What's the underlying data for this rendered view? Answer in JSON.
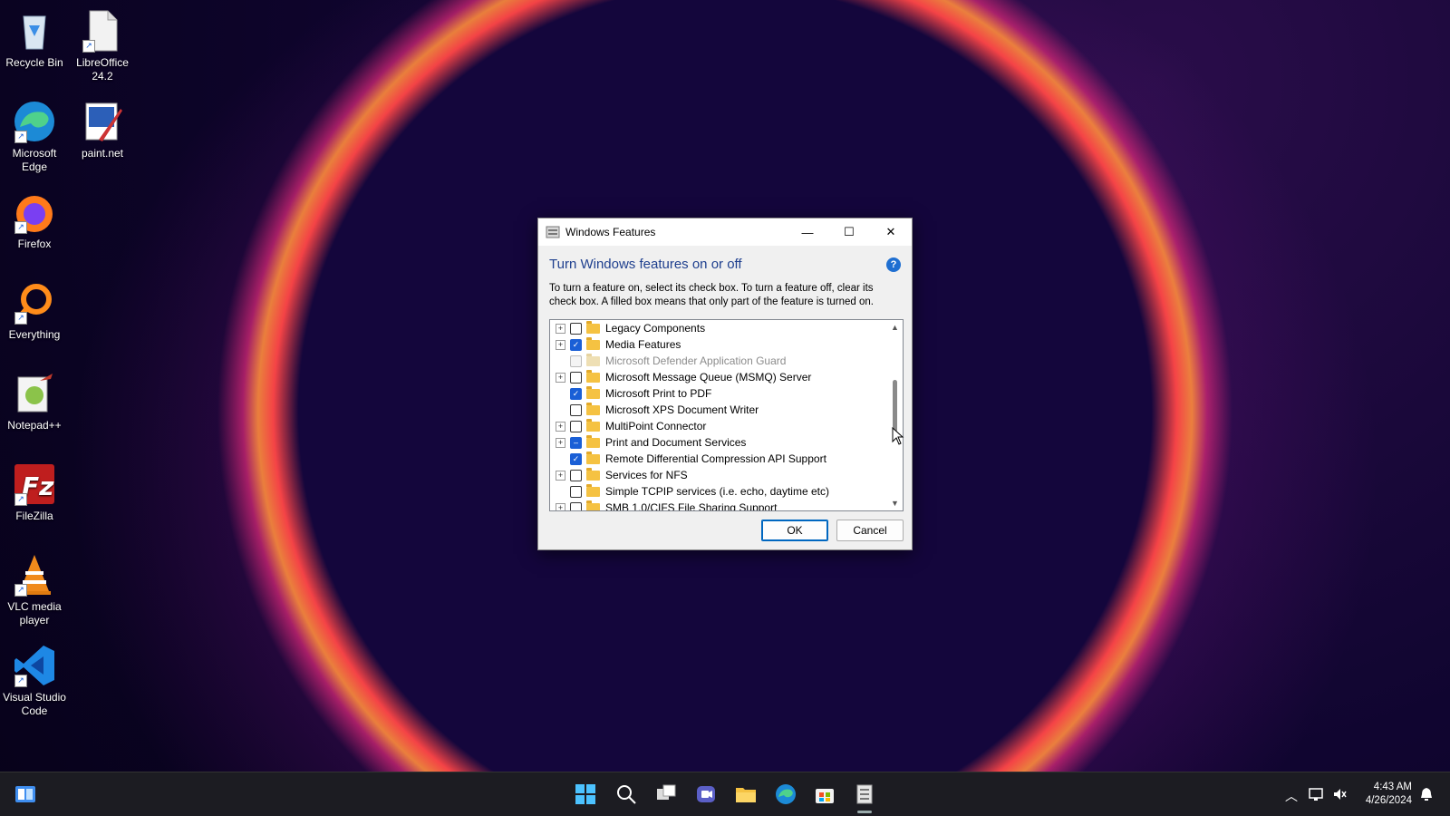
{
  "desktop": {
    "icons": [
      {
        "label": "Recycle Bin",
        "icon": "recycle-bin-icon"
      },
      {
        "label": "LibreOffice 24.2",
        "icon": "libreoffice-icon"
      },
      {
        "label": "Microsoft Edge",
        "icon": "edge-icon"
      },
      {
        "label": "paint.net",
        "icon": "paintnet-icon"
      },
      {
        "label": "Firefox",
        "icon": "firefox-icon"
      },
      {
        "label": "Everything",
        "icon": "everything-icon"
      },
      {
        "label": "Notepad++",
        "icon": "notepadpp-icon"
      },
      {
        "label": "FileZilla",
        "icon": "filezilla-icon"
      },
      {
        "label": "VLC media player",
        "icon": "vlc-icon"
      },
      {
        "label": "Visual Studio Code",
        "icon": "vscode-icon"
      }
    ]
  },
  "dialog": {
    "title": "Windows Features",
    "heading": "Turn Windows features on or off",
    "help_glyph": "?",
    "description": "To turn a feature on, select its check box. To turn a feature off, clear its check box. A filled box means that only part of the feature is turned on.",
    "features": [
      {
        "label": "Legacy Components",
        "expandable": true,
        "state": "unchecked",
        "disabled": false
      },
      {
        "label": "Media Features",
        "expandable": true,
        "state": "checked",
        "disabled": false
      },
      {
        "label": "Microsoft Defender Application Guard",
        "expandable": false,
        "state": "unchecked",
        "disabled": true
      },
      {
        "label": "Microsoft Message Queue (MSMQ) Server",
        "expandable": true,
        "state": "unchecked",
        "disabled": false
      },
      {
        "label": "Microsoft Print to PDF",
        "expandable": false,
        "state": "checked",
        "disabled": false
      },
      {
        "label": "Microsoft XPS Document Writer",
        "expandable": false,
        "state": "unchecked",
        "disabled": false
      },
      {
        "label": "MultiPoint Connector",
        "expandable": true,
        "state": "unchecked",
        "disabled": false
      },
      {
        "label": "Print and Document Services",
        "expandable": true,
        "state": "partial",
        "disabled": false
      },
      {
        "label": "Remote Differential Compression API Support",
        "expandable": false,
        "state": "checked",
        "disabled": false
      },
      {
        "label": "Services for NFS",
        "expandable": true,
        "state": "unchecked",
        "disabled": false
      },
      {
        "label": "Simple TCPIP services (i.e. echo, daytime etc)",
        "expandable": false,
        "state": "unchecked",
        "disabled": false
      },
      {
        "label": "SMB 1.0/CIFS File Sharing Support",
        "expandable": true,
        "state": "unchecked",
        "disabled": false
      }
    ],
    "ok_label": "OK",
    "cancel_label": "Cancel"
  },
  "taskbar": {
    "time": "4:43 AM",
    "date": "4/26/2024",
    "pinned": [
      "start-icon",
      "search-icon",
      "task-view-icon",
      "meet-icon",
      "file-explorer-icon",
      "edge-icon",
      "store-icon",
      "windows-features-icon"
    ]
  },
  "colors": {
    "accent": "#1a5fd6",
    "heading": "#1e3f8e"
  }
}
